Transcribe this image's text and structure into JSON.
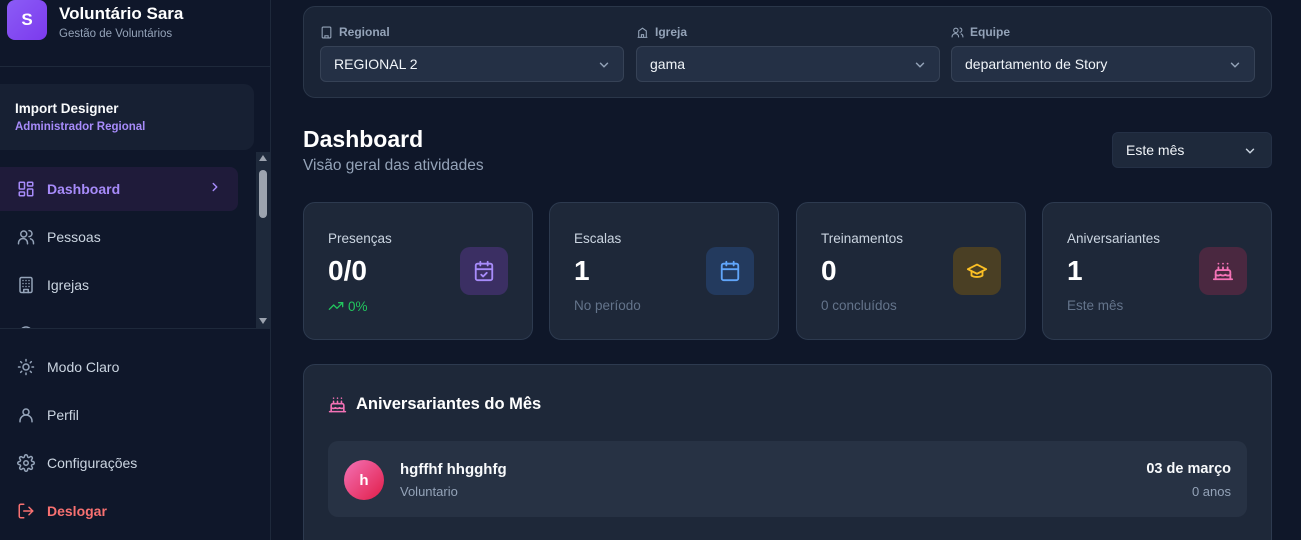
{
  "brand": {
    "logo_letter": "S",
    "title": "Voluntário Sara",
    "subtitle": "Gestão de Voluntários"
  },
  "user": {
    "name": "Import Designer",
    "role": "Administrador Regional"
  },
  "nav": {
    "items": [
      {
        "label": "Dashboard",
        "icon": "dashboard-icon",
        "active": true
      },
      {
        "label": "Pessoas",
        "icon": "users-icon"
      },
      {
        "label": "Igrejas",
        "icon": "building-icon"
      }
    ]
  },
  "bottom_nav": {
    "theme": "Modo Claro",
    "profile": "Perfil",
    "settings": "Configurações",
    "logout": "Deslogar"
  },
  "filters": {
    "regional": {
      "label": "Regional",
      "value": "REGIONAL 2"
    },
    "igreja": {
      "label": "Igreja",
      "value": "gama"
    },
    "equipe": {
      "label": "Equipe",
      "value": "departamento de Story"
    }
  },
  "header": {
    "title": "Dashboard",
    "subtitle": "Visão geral das atividades",
    "period": "Este mês"
  },
  "stats": [
    {
      "label": "Presenças",
      "value": "0/0",
      "sub": "0%",
      "icon": "calendar-check-icon"
    },
    {
      "label": "Escalas",
      "value": "1",
      "sub": "No período",
      "icon": "calendar-icon"
    },
    {
      "label": "Treinamentos",
      "value": "0",
      "sub": "0 concluídos",
      "icon": "graduation-cap-icon"
    },
    {
      "label": "Aniversariantes",
      "value": "1",
      "sub": "Este mês",
      "icon": "cake-icon"
    }
  ],
  "birthdays": {
    "title": "Aniversariantes do Mês",
    "items": [
      {
        "initial": "h",
        "name": "hgffhf hhgghfg",
        "role": "Voluntario",
        "date": "03 de março",
        "age": "0 anos"
      }
    ]
  },
  "colors": {
    "background": "#0f1729",
    "accent": "#a78bfa",
    "success": "#22c55e",
    "danger": "#f87171"
  }
}
